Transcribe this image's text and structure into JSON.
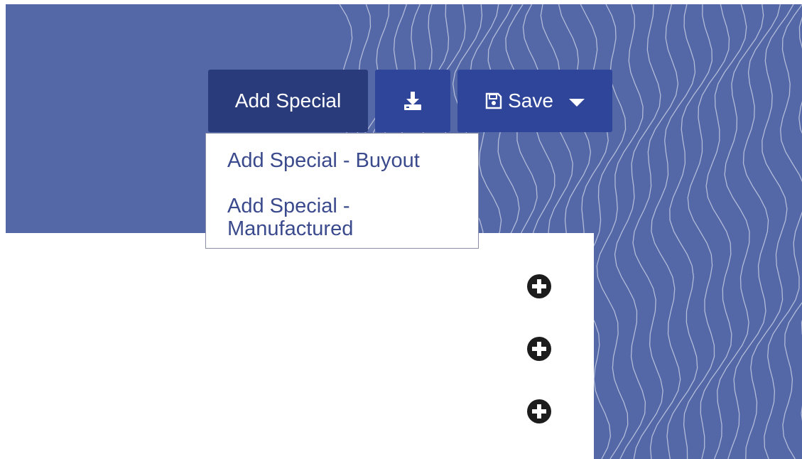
{
  "toolbar": {
    "add_special_label": "Add Special",
    "save_label": "Save"
  },
  "dropdown": {
    "items": [
      {
        "label": "Add Special - Buyout"
      },
      {
        "label": "Add Special - Manufactured"
      }
    ]
  },
  "icons": {
    "download": "download-icon",
    "save": "floppy-disk-icon",
    "caret": "caret-down-icon",
    "add": "plus-circle-icon"
  },
  "colors": {
    "background": "#5468a8",
    "primary_button": "#293b7b",
    "secondary_button": "#2f459a",
    "menu_text": "#3a4a8c"
  }
}
